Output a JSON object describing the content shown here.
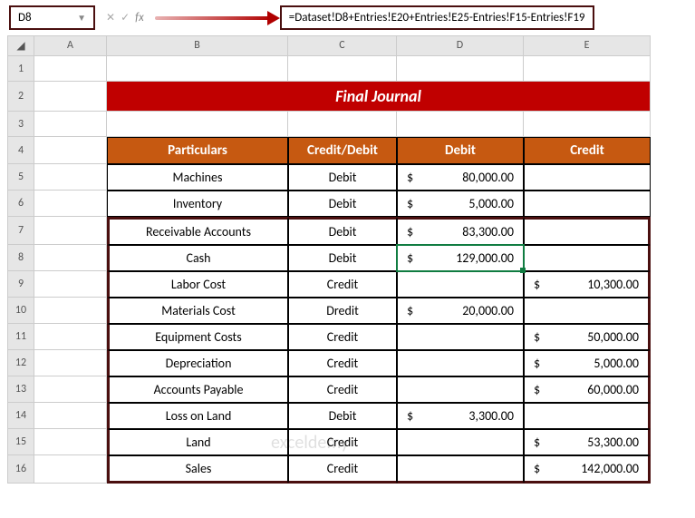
{
  "name_box": "D8",
  "formula": "=Dataset!D8+Entries!E20+Entries!E25-Entries!F15-Entries!F19",
  "columns": [
    "A",
    "B",
    "C",
    "D",
    "E"
  ],
  "title": "Final Journal",
  "headers": {
    "particulars": "Particulars",
    "cd": "Credit/Debit",
    "debit": "Debit",
    "credit": "Credit"
  },
  "rows": [
    {
      "r": 5,
      "p": "Machines",
      "cd": "Debit",
      "d": "80,000.00",
      "c": ""
    },
    {
      "r": 6,
      "p": "Inventory",
      "cd": "Debit",
      "d": "5,000.00",
      "c": ""
    },
    {
      "r": 7,
      "p": "Receivable Accounts",
      "cd": "Debit",
      "d": "83,300.00",
      "c": ""
    },
    {
      "r": 8,
      "p": "Cash",
      "cd": "Debit",
      "d": "129,000.00",
      "c": ""
    },
    {
      "r": 9,
      "p": "Labor Cost",
      "cd": "Credit",
      "d": "",
      "c": "10,300.00"
    },
    {
      "r": 10,
      "p": "Materials Cost",
      "cd": "Dredit",
      "d": "20,000.00",
      "c": ""
    },
    {
      "r": 11,
      "p": "Equipment Costs",
      "cd": "Credit",
      "d": "",
      "c": "50,000.00"
    },
    {
      "r": 12,
      "p": "Depreciation",
      "cd": "Credit",
      "d": "",
      "c": "5,000.00"
    },
    {
      "r": 13,
      "p": "Accounts Payable",
      "cd": "Credit",
      "d": "",
      "c": "60,000.00"
    },
    {
      "r": 14,
      "p": "Loss on Land",
      "cd": "Debit",
      "d": "3,300.00",
      "c": ""
    },
    {
      "r": 15,
      "p": "Land",
      "cd": "Credit",
      "d": "",
      "c": "53,300.00"
    },
    {
      "r": 16,
      "p": "Sales",
      "cd": "Credit",
      "d": "",
      "c": "142,000.00"
    }
  ],
  "watermark": "exceldemy",
  "chart_data": {
    "type": "table",
    "title": "Final Journal",
    "columns": [
      "Particulars",
      "Credit/Debit",
      "Debit",
      "Credit"
    ],
    "rows": [
      [
        "Machines",
        "Debit",
        80000.0,
        null
      ],
      [
        "Inventory",
        "Debit",
        5000.0,
        null
      ],
      [
        "Receivable Accounts",
        "Debit",
        83300.0,
        null
      ],
      [
        "Cash",
        "Debit",
        129000.0,
        null
      ],
      [
        "Labor Cost",
        "Credit",
        null,
        10300.0
      ],
      [
        "Materials Cost",
        "Dredit",
        20000.0,
        null
      ],
      [
        "Equipment Costs",
        "Credit",
        null,
        50000.0
      ],
      [
        "Depreciation",
        "Credit",
        null,
        5000.0
      ],
      [
        "Accounts Payable",
        "Credit",
        null,
        60000.0
      ],
      [
        "Loss on Land",
        "Debit",
        3300.0,
        null
      ],
      [
        "Land",
        "Credit",
        null,
        53300.0
      ],
      [
        "Sales",
        "Credit",
        null,
        142000.0
      ]
    ]
  }
}
